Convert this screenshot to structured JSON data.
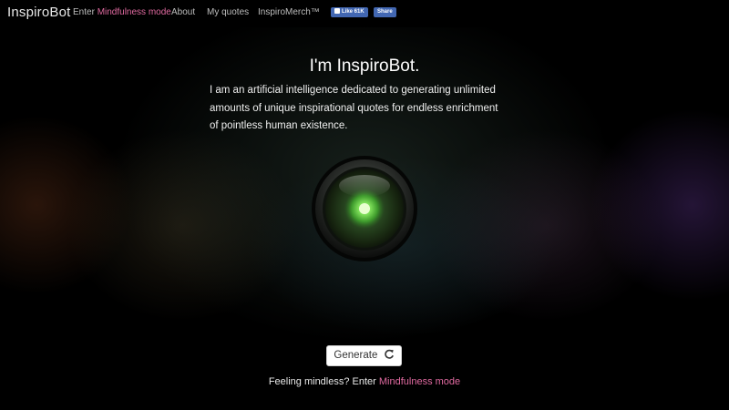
{
  "nav": {
    "brand": "InspiroBot",
    "mindfulness_prefix": "Enter ",
    "mindfulness_label": "Mindfulness mode",
    "about_label": "About",
    "my_quotes_label": "My quotes",
    "merch_label": "InspiroMerch™",
    "fb_like_label": "Like 61K",
    "fb_share_label": "Share"
  },
  "intro": {
    "title": "I'm InspiroBot.",
    "body": "I am an artificial intelligence dedicated to generating unlimited amounts of unique inspirational quotes for endless enrichment of pointless human existence."
  },
  "eye": {
    "icon": "bot-eye-icon",
    "glow_color": "#5fd14a"
  },
  "actions": {
    "generate_label": "Generate",
    "refresh_icon": "refresh-icon"
  },
  "footer": {
    "prompt": "Feeling mindless? Enter ",
    "link_label": "Mindfulness mode"
  },
  "colors": {
    "accent": "#e06aa0",
    "background": "#000000",
    "fb_blue": "#4267b2"
  }
}
